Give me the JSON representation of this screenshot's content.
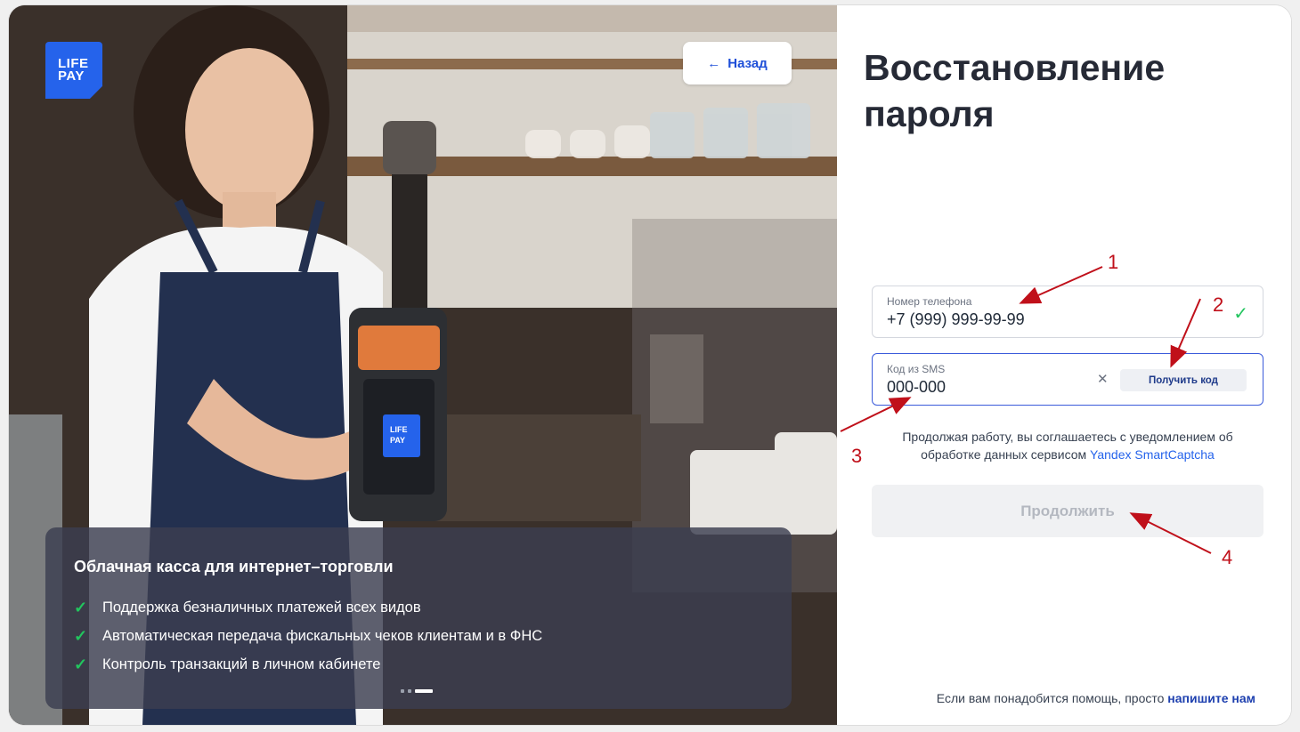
{
  "brand": {
    "logo_line1": "LIFE",
    "logo_line2": "PAY",
    "accent": "#2563eb"
  },
  "header": {
    "back_label": "Назад",
    "back_icon": "arrow-left-icon"
  },
  "promo": {
    "title": "Облачная касса для интернет–торговли",
    "features": [
      "Поддержка безналичных платежей всех видов",
      "Автоматическая передача фискальных чеков клиентам и в ФНС",
      "Контроль транзакций в личном кабинете"
    ],
    "slides_total": 3,
    "slide_active": 3
  },
  "form": {
    "title": "Восстановление пароля",
    "phone": {
      "label": "Номер телефона",
      "value": "+7 (999) 999-99-99",
      "status_icon": "check-icon"
    },
    "sms": {
      "label": "Код из SMS",
      "value": "000-000",
      "clear_icon": "close-icon",
      "get_code_label": "Получить код"
    },
    "consent_text": "Продолжая работу, вы соглашаетесь с уведомлением об обработке данных сервисом",
    "consent_link": "Yandex SmartCaptcha",
    "continue_label": "Продолжить",
    "help_text": "Если вам понадобится помощь, просто",
    "help_link": "напишите нам"
  },
  "annotations": {
    "n1": "1",
    "n2": "2",
    "n3": "3",
    "n4": "4",
    "color": "#c0101a"
  }
}
